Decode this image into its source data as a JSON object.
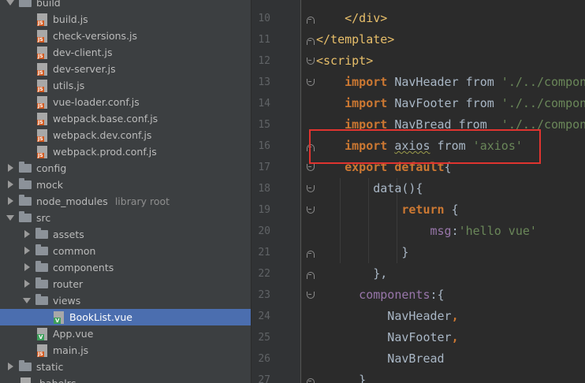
{
  "tree": {
    "items": [
      {
        "label": "build",
        "type": "folder",
        "state": "open",
        "depth": 1
      },
      {
        "label": "build.js",
        "type": "js",
        "depth": 2
      },
      {
        "label": "check-versions.js",
        "type": "js",
        "depth": 2
      },
      {
        "label": "dev-client.js",
        "type": "js",
        "depth": 2
      },
      {
        "label": "dev-server.js",
        "type": "js",
        "depth": 2
      },
      {
        "label": "utils.js",
        "type": "js",
        "depth": 2
      },
      {
        "label": "vue-loader.conf.js",
        "type": "js",
        "depth": 2
      },
      {
        "label": "webpack.base.conf.js",
        "type": "js",
        "depth": 2
      },
      {
        "label": "webpack.dev.conf.js",
        "type": "js",
        "depth": 2
      },
      {
        "label": "webpack.prod.conf.js",
        "type": "js",
        "depth": 2
      },
      {
        "label": "config",
        "type": "folder",
        "state": "closed",
        "depth": 1
      },
      {
        "label": "mock",
        "type": "folder",
        "state": "closed",
        "depth": 1
      },
      {
        "label": "node_modules",
        "type": "folder",
        "state": "closed",
        "depth": 1,
        "hint": "library root"
      },
      {
        "label": "src",
        "type": "folder",
        "state": "open",
        "depth": 1
      },
      {
        "label": "assets",
        "type": "folder",
        "state": "closed",
        "depth": 2
      },
      {
        "label": "common",
        "type": "folder",
        "state": "closed",
        "depth": 2
      },
      {
        "label": "components",
        "type": "folder",
        "state": "closed",
        "depth": 2
      },
      {
        "label": "router",
        "type": "folder",
        "state": "closed",
        "depth": 2
      },
      {
        "label": "views",
        "type": "folder",
        "state": "open",
        "depth": 2
      },
      {
        "label": "BookList.vue",
        "type": "vue",
        "depth": 3,
        "selected": true
      },
      {
        "label": "App.vue",
        "type": "vue",
        "depth": 2
      },
      {
        "label": "main.js",
        "type": "js",
        "depth": 2
      },
      {
        "label": "static",
        "type": "folder",
        "state": "closed",
        "depth": 1
      },
      {
        "label": ".babelrc",
        "type": "js",
        "depth": 1
      }
    ]
  },
  "editor": {
    "lines": [
      {
        "num": "10",
        "fold": "close",
        "indent": 1,
        "tokens": [
          {
            "t": "</div>",
            "c": "tag"
          }
        ]
      },
      {
        "num": "11",
        "fold": "close",
        "indent": 0,
        "tokens": [
          {
            "t": "</template>",
            "c": "tag"
          }
        ]
      },
      {
        "num": "12",
        "fold": "open",
        "indent": 0,
        "tokens": [
          {
            "t": "<script>",
            "c": "tag"
          }
        ]
      },
      {
        "num": "13",
        "fold": "open",
        "indent": 1,
        "tokens": [
          {
            "t": "import",
            "c": "kw"
          },
          {
            "t": " NavHeader ",
            "c": "plain"
          },
          {
            "t": "from",
            "c": "plain"
          },
          {
            "t": " './../components/NavHeader'",
            "c": "str"
          }
        ]
      },
      {
        "num": "14",
        "fold": "",
        "indent": 1,
        "tokens": [
          {
            "t": "import",
            "c": "kw"
          },
          {
            "t": " NavFooter ",
            "c": "plain"
          },
          {
            "t": "from",
            "c": "plain"
          },
          {
            "t": " './../components/NavFooter'",
            "c": "str"
          }
        ]
      },
      {
        "num": "15",
        "fold": "",
        "indent": 1,
        "tokens": [
          {
            "t": "import",
            "c": "kw"
          },
          {
            "t": " NavBread ",
            "c": "plain"
          },
          {
            "t": "from",
            "c": "plain"
          },
          {
            "t": "  './../components/NavBread'",
            "c": "str"
          }
        ]
      },
      {
        "num": "16",
        "fold": "close",
        "indent": 1,
        "tokens": [
          {
            "t": "import",
            "c": "kw"
          },
          {
            "t": " ",
            "c": "plain"
          },
          {
            "t": "axios",
            "c": "plain squiggle"
          },
          {
            "t": " from ",
            "c": "plain"
          },
          {
            "t": "'axios'",
            "c": "str"
          }
        ]
      },
      {
        "num": "17",
        "fold": "open",
        "indent": 1,
        "tokens": [
          {
            "t": "export",
            "c": "kw"
          },
          {
            "t": " ",
            "c": "plain"
          },
          {
            "t": "default",
            "c": "kw"
          },
          {
            "t": "{",
            "c": "plain"
          }
        ]
      },
      {
        "num": "18",
        "fold": "open",
        "indent": 2,
        "tokens": [
          {
            "t": "data",
            "c": "plain"
          },
          {
            "t": "(){",
            "c": "plain"
          }
        ]
      },
      {
        "num": "19",
        "fold": "open",
        "indent": 3,
        "tokens": [
          {
            "t": "return",
            "c": "kw"
          },
          {
            "t": " {",
            "c": "plain"
          }
        ]
      },
      {
        "num": "20",
        "fold": "",
        "indent": 4,
        "tokens": [
          {
            "t": "msg",
            "c": "prop"
          },
          {
            "t": ":",
            "c": "plain"
          },
          {
            "t": "'hello vue'",
            "c": "str"
          }
        ]
      },
      {
        "num": "21",
        "fold": "close",
        "indent": 3,
        "tokens": [
          {
            "t": "}",
            "c": "plain"
          }
        ]
      },
      {
        "num": "22",
        "fold": "close",
        "indent": 2,
        "tokens": [
          {
            "t": "},",
            "c": "plain"
          }
        ]
      },
      {
        "num": "23",
        "fold": "open",
        "indent": 1.5,
        "tokens": [
          {
            "t": "components",
            "c": "prop"
          },
          {
            "t": ":{",
            "c": "plain"
          }
        ]
      },
      {
        "num": "24",
        "fold": "",
        "indent": 2.5,
        "tokens": [
          {
            "t": "NavHeader",
            "c": "plain"
          },
          {
            "t": ",",
            "c": "kw"
          }
        ]
      },
      {
        "num": "25",
        "fold": "",
        "indent": 2.5,
        "tokens": [
          {
            "t": "NavFooter",
            "c": "plain"
          },
          {
            "t": ",",
            "c": "kw"
          }
        ]
      },
      {
        "num": "26",
        "fold": "",
        "indent": 2.5,
        "tokens": [
          {
            "t": "NavBread",
            "c": "plain"
          }
        ]
      },
      {
        "num": "27",
        "fold": "close",
        "indent": 1.5,
        "tokens": [
          {
            "t": "}",
            "c": "plain"
          }
        ]
      }
    ]
  }
}
